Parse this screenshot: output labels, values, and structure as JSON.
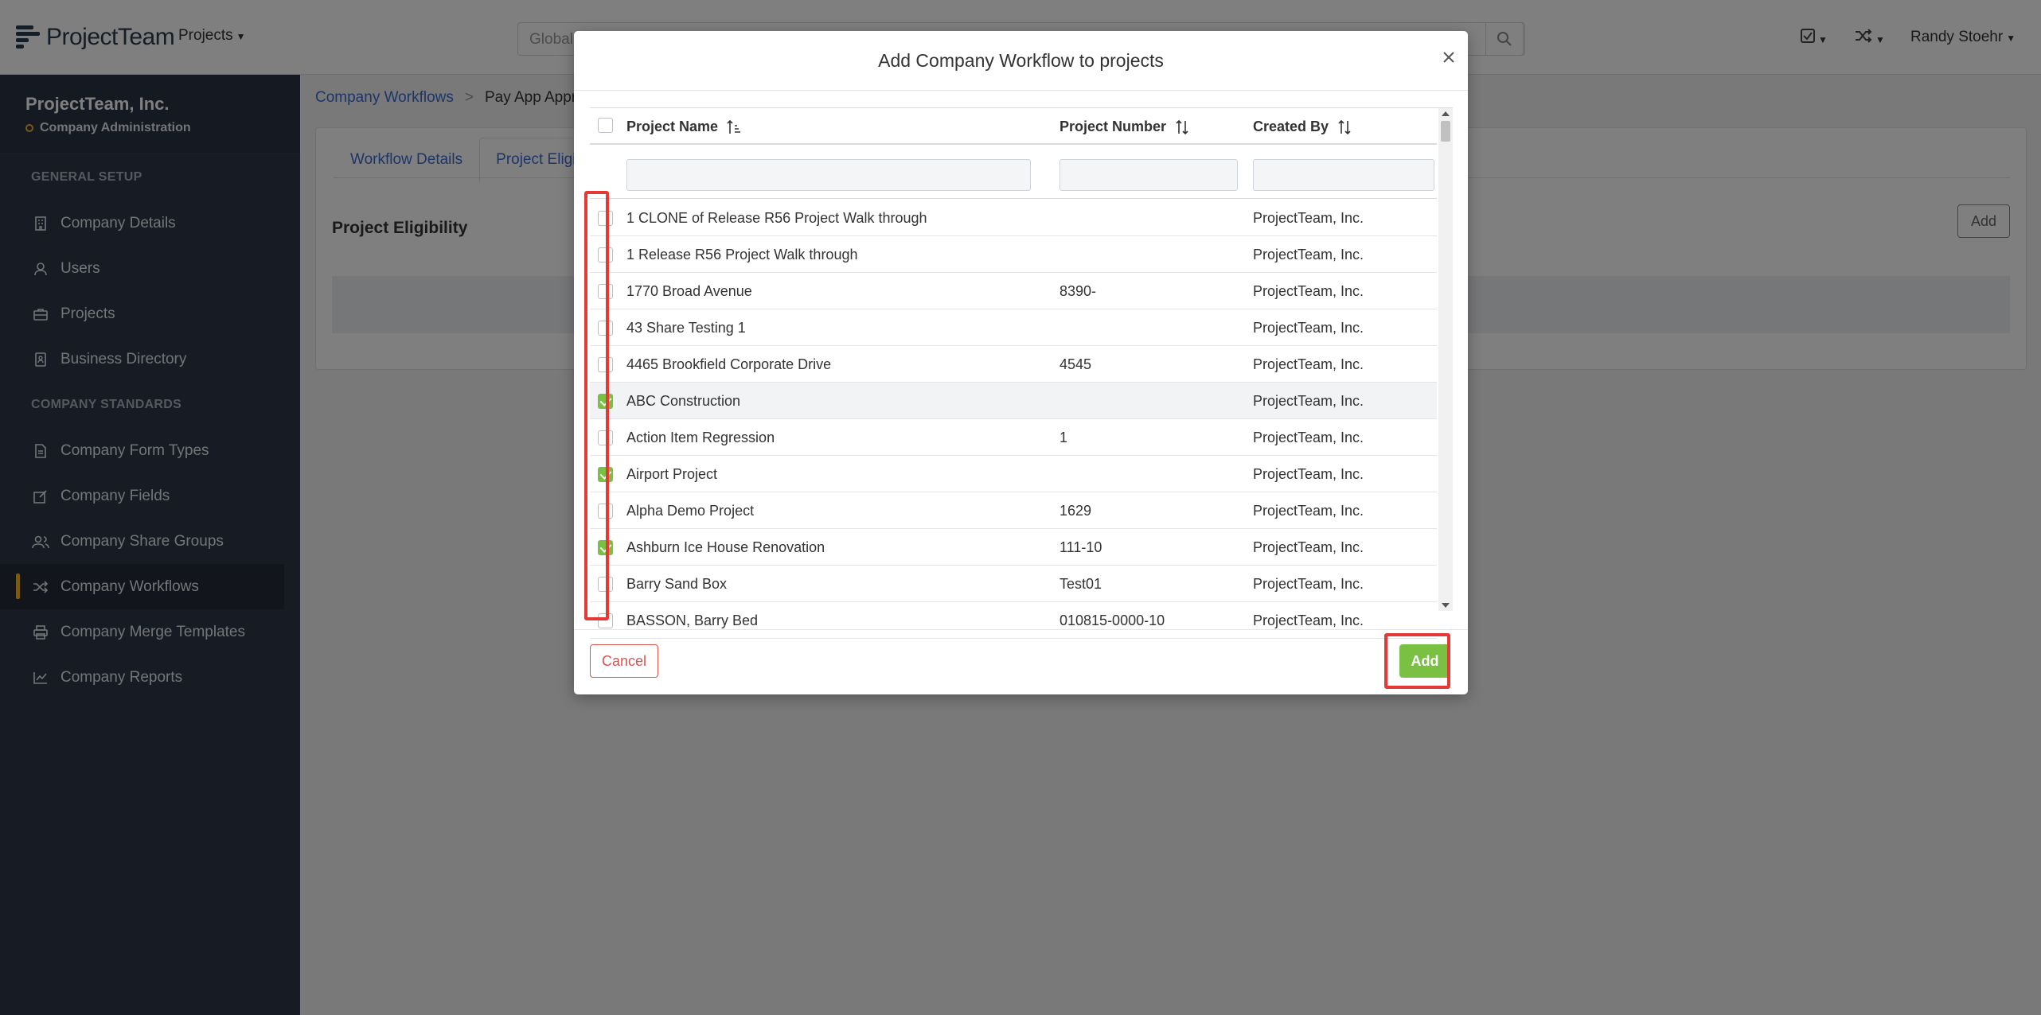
{
  "app": {
    "logo_text": "ProjectTeam",
    "nav_projects": "Projects",
    "search_placeholder": "Global",
    "user_name": "Randy Stoehr"
  },
  "sidebar": {
    "org_name": "ProjectTeam, Inc.",
    "org_role": "Company Administration",
    "section_general": "GENERAL SETUP",
    "section_standards": "COMPANY STANDARDS",
    "general_items": [
      {
        "label": "Company Details",
        "icon": "building-icon"
      },
      {
        "label": "Users",
        "icon": "user-icon"
      },
      {
        "label": "Projects",
        "icon": "briefcase-icon"
      },
      {
        "label": "Business Directory",
        "icon": "address-book-icon"
      }
    ],
    "standard_items": [
      {
        "label": "Company Form Types",
        "icon": "document-icon"
      },
      {
        "label": "Company Fields",
        "icon": "edit-icon"
      },
      {
        "label": "Company Share Groups",
        "icon": "users-icon"
      },
      {
        "label": "Company Workflows",
        "icon": "shuffle-icon",
        "active": true
      },
      {
        "label": "Company Merge Templates",
        "icon": "printer-icon"
      },
      {
        "label": "Company Reports",
        "icon": "chart-icon"
      }
    ]
  },
  "main": {
    "breadcrumb": {
      "parent": "Company Workflows",
      "current": "Pay App Appro"
    },
    "tabs": [
      "Workflow Details",
      "Project Eligib"
    ],
    "section_title": "Project Eligibility",
    "add_label": "Add"
  },
  "modal": {
    "title": "Add Company Workflow to projects",
    "columns": {
      "name": "Project Name",
      "number": "Project Number",
      "created_by": "Created By"
    },
    "rows": [
      {
        "name": "1 CLONE of Release R56 Project Walk through",
        "number": "",
        "created_by": "ProjectTeam, Inc.",
        "checked": false
      },
      {
        "name": "1 Release R56 Project Walk through",
        "number": "",
        "created_by": "ProjectTeam, Inc.",
        "checked": false
      },
      {
        "name": "1770 Broad Avenue",
        "number": "8390-",
        "created_by": "ProjectTeam, Inc.",
        "checked": false
      },
      {
        "name": "43 Share Testing 1",
        "number": "",
        "created_by": "ProjectTeam, Inc.",
        "checked": false
      },
      {
        "name": "4465 Brookfield Corporate Drive",
        "number": "4545",
        "created_by": "ProjectTeam, Inc.",
        "checked": false
      },
      {
        "name": "ABC Construction",
        "number": "",
        "created_by": "ProjectTeam, Inc.",
        "checked": true
      },
      {
        "name": "Action Item Regression",
        "number": "1",
        "created_by": "ProjectTeam, Inc.",
        "checked": false
      },
      {
        "name": "Airport Project",
        "number": "",
        "created_by": "ProjectTeam, Inc.",
        "checked": true
      },
      {
        "name": "Alpha Demo Project",
        "number": "1629",
        "created_by": "ProjectTeam, Inc.",
        "checked": false
      },
      {
        "name": "Ashburn Ice House Renovation",
        "number": "111-10",
        "created_by": "ProjectTeam, Inc.",
        "checked": true
      },
      {
        "name": "Barry Sand Box",
        "number": "Test01",
        "created_by": "ProjectTeam, Inc.",
        "checked": false
      },
      {
        "name": "BASSON, Barry Bed",
        "number": "010815-0000-10",
        "created_by": "ProjectTeam, Inc.",
        "checked": false
      }
    ],
    "cancel_label": "Cancel",
    "add_label": "Add"
  }
}
